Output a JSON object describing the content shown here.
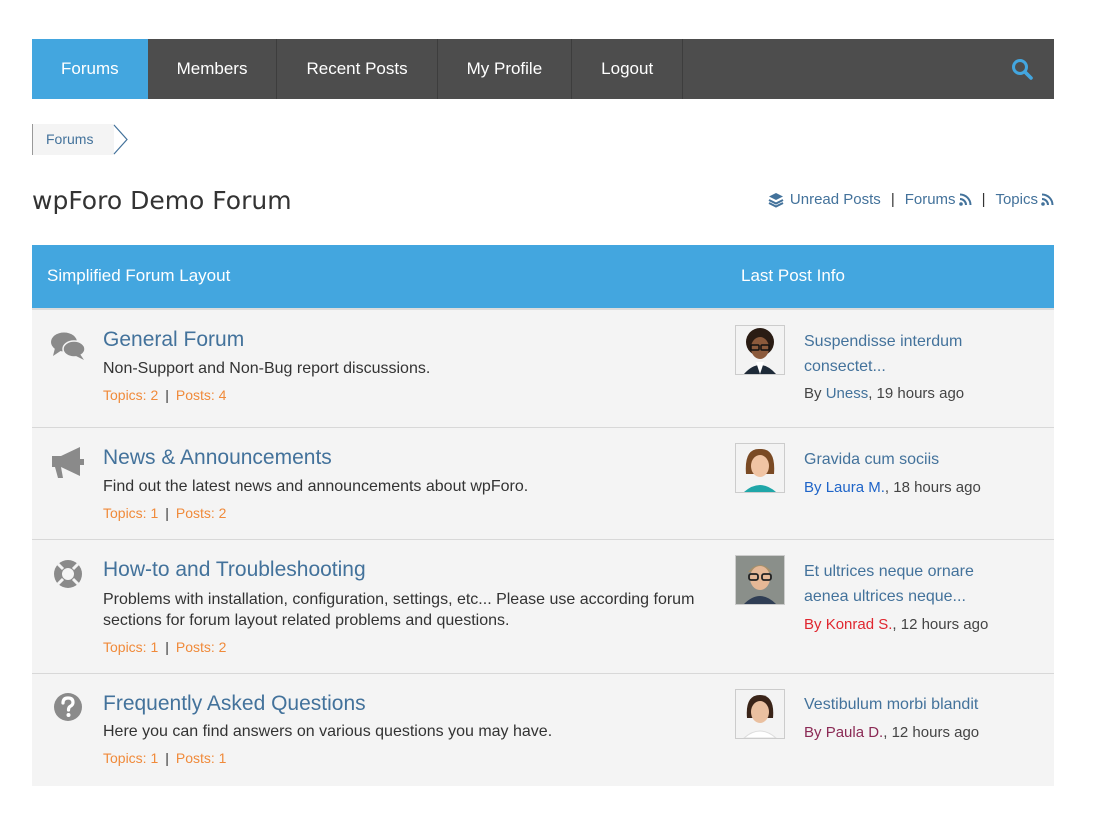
{
  "nav": {
    "items": [
      {
        "label": "Forums"
      },
      {
        "label": "Members"
      },
      {
        "label": "Recent Posts"
      },
      {
        "label": "My Profile"
      },
      {
        "label": "Logout"
      }
    ]
  },
  "breadcrumb": {
    "label": "Forums"
  },
  "page": {
    "title": "wpForo Demo Forum"
  },
  "header_links": {
    "unread": "Unread Posts",
    "forums": "Forums",
    "topics": "Topics",
    "separator": "|"
  },
  "table": {
    "left_header": "Simplified Forum Layout",
    "right_header": "Last Post Info"
  },
  "colors": {
    "accent": "#43a6df",
    "nav_bg": "#4d4d4d",
    "link": "#43729b",
    "stats": "#f08a3a"
  },
  "forums": [
    {
      "icon": "comments-icon",
      "title": "General Forum",
      "description": "Non-Support and Non-Bug report discussions.",
      "topics": "Topics: 2",
      "posts": "Posts: 4",
      "last_post": {
        "title": "Suspendisse interdum consectet...",
        "by": "By ",
        "author": "Uness",
        "author_color": "#43729b",
        "time": ", 19 hours ago"
      }
    },
    {
      "icon": "bullhorn-icon",
      "title": "News & Announcements",
      "description": "Find out the latest news and announcements about wpForo.",
      "topics": "Topics: 1",
      "posts": "Posts: 2",
      "last_post": {
        "title": "Gravida cum sociis",
        "by": "By ",
        "author": "Laura M.",
        "author_color": "#1e64c8",
        "time": ", 18 hours ago"
      }
    },
    {
      "icon": "life-ring-icon",
      "title": "How-to and Troubleshooting",
      "description": "Problems with installation, configuration, settings, etc... Please use according forum sections for forum layout related problems and questions.",
      "topics": "Topics: 1",
      "posts": "Posts: 2",
      "last_post": {
        "title": "Et ultrices neque ornare aenea ultrices neque...",
        "by": "By ",
        "author": "Konrad S.",
        "author_color": "#e0262f",
        "time": ", 12 hours ago"
      }
    },
    {
      "icon": "question-circle-icon",
      "title": "Frequently Asked Questions",
      "description": "Here you can find answers on various questions you may have.",
      "topics": "Topics: 1",
      "posts": "Posts: 1",
      "last_post": {
        "title": "Vestibulum morbi blandit",
        "by": "By ",
        "author": "Paula D.",
        "author_color": "#8b2a55",
        "time": ", 12 hours ago"
      }
    }
  ]
}
